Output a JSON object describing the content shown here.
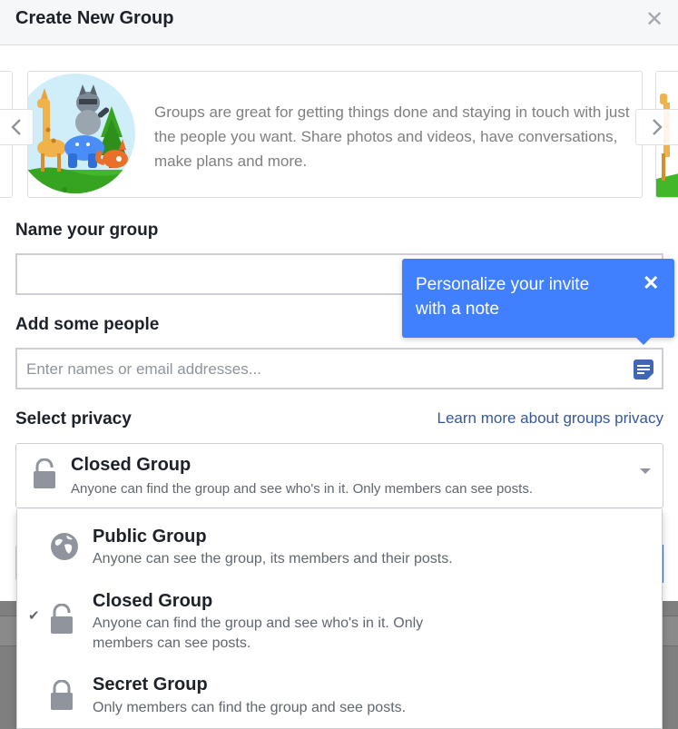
{
  "dialog": {
    "title": "Create New Group",
    "close_icon": "close-icon"
  },
  "carousel": {
    "text": "Groups are great for getting things done and staying in touch with just the people you want. Share photos and videos, have conversations, make plans and more.",
    "prev_icon": "chevron-left-icon",
    "next_icon": "chevron-right-icon"
  },
  "form": {
    "name_label": "Name your group",
    "name_value": "",
    "people_label": "Add some people",
    "people_placeholder": "Enter names or email addresses...",
    "privacy_label": "Select privacy",
    "learn_more": "Learn more about groups privacy"
  },
  "tooltip": {
    "text": "Personalize your invite with a note",
    "close": "×"
  },
  "privacy_select": {
    "selected_title": "Closed Group",
    "selected_desc": "Anyone can find the group and see who's in it. Only members can see posts.",
    "icon": "lock-open-icon"
  },
  "privacy_options": [
    {
      "title": "Public Group",
      "desc": "Anyone can see the group, its members and their posts.",
      "icon": "globe-icon",
      "selected": false
    },
    {
      "title": "Closed Group",
      "desc": "Anyone can find the group and see who's in it. Only members can see posts.",
      "icon": "lock-open-icon",
      "selected": true
    },
    {
      "title": "Secret Group",
      "desc": "Only members can find the group and see posts.",
      "icon": "lock-icon",
      "selected": false
    }
  ],
  "colors": {
    "tooltip_bg": "#4080ff",
    "link": "#365899",
    "header_bg": "#f6f7f9",
    "text_primary": "#1d2129",
    "text_secondary": "#606770"
  }
}
